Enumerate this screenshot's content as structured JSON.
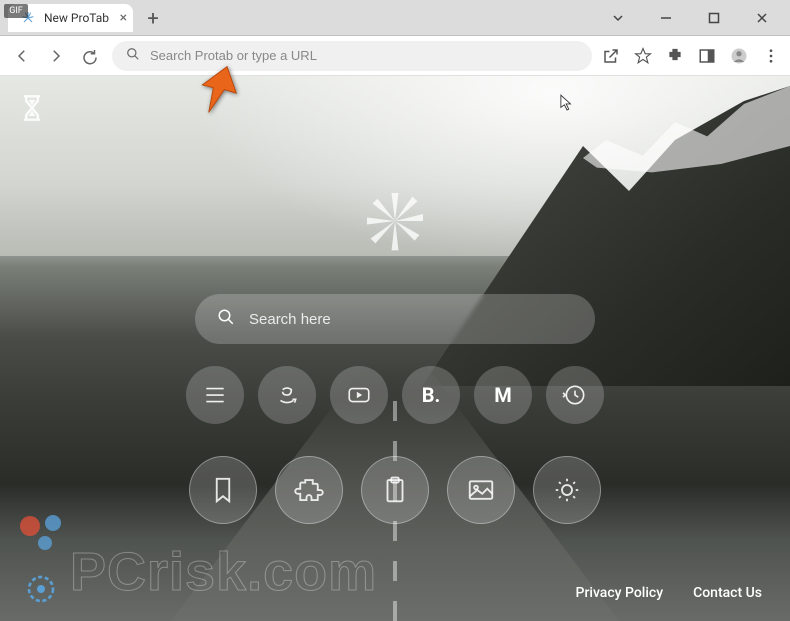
{
  "tab": {
    "title": "New ProTab"
  },
  "toolbar": {
    "address_placeholder": "Search Protab or type a URL"
  },
  "page": {
    "search_placeholder": "Search here",
    "shortcuts_row1": [
      {
        "name": "list-icon"
      },
      {
        "name": "amazon-icon"
      },
      {
        "name": "youtube-icon"
      },
      {
        "name": "booking-icon",
        "letter": "B."
      },
      {
        "name": "gmail-icon",
        "letter": "M"
      },
      {
        "name": "history-icon"
      }
    ],
    "shortcuts_row2": [
      {
        "name": "bookmark-icon"
      },
      {
        "name": "extension-icon"
      },
      {
        "name": "clipboard-icon"
      },
      {
        "name": "image-icon"
      },
      {
        "name": "weather-icon"
      }
    ],
    "footer": {
      "privacy": "Privacy Policy",
      "contact": "Contact Us"
    }
  },
  "watermark": {
    "text": "PCrisk.com"
  },
  "gif": "GIF"
}
